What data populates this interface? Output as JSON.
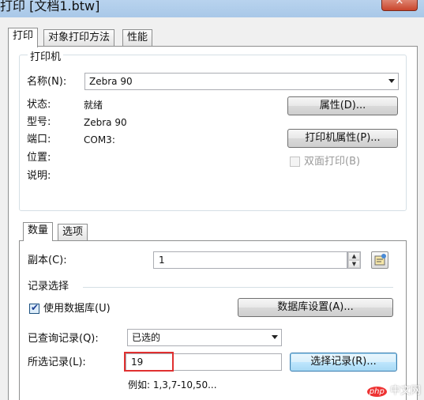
{
  "window": {
    "title": "打印 [文档1.btw]",
    "close_label": "×"
  },
  "tabs": [
    {
      "label": "打印",
      "active": true
    },
    {
      "label": "对象打印方法",
      "active": false
    },
    {
      "label": "性能",
      "active": false
    }
  ],
  "printer": {
    "group_label": "打印机",
    "name_label": "名称(N):",
    "name_value": "Zebra 90",
    "status_label": "状态:",
    "status_value": "就绪",
    "model_label": "型号:",
    "model_value": "Zebra 90",
    "port_label": "端口:",
    "port_value": "COM3:",
    "location_label": "位置:",
    "comment_label": "说明:",
    "properties_button": "属性(D)...",
    "printer_properties_button": "打印机属性(P)...",
    "duplex_label": "双面打印(B)"
  },
  "subtabs": [
    {
      "label": "数量",
      "active": true
    },
    {
      "label": "选项",
      "active": false
    }
  ],
  "quantity": {
    "copies_label": "副本(C):",
    "copies_value": "1",
    "record_group_label": "记录选择",
    "use_database_label": "使用数据库(U)",
    "use_database_checked": true,
    "database_settings_button": "数据库设置(A)...",
    "queried_records_label": "已查询记录(Q):",
    "queried_records_value": "已选的",
    "selected_records_label": "所选记录(L):",
    "selected_records_value": "19",
    "select_records_button": "选择记录(R)...",
    "example_text": "例如: 1,3,7-10,50..."
  },
  "watermark": {
    "badge": "php",
    "site": "中文网"
  }
}
